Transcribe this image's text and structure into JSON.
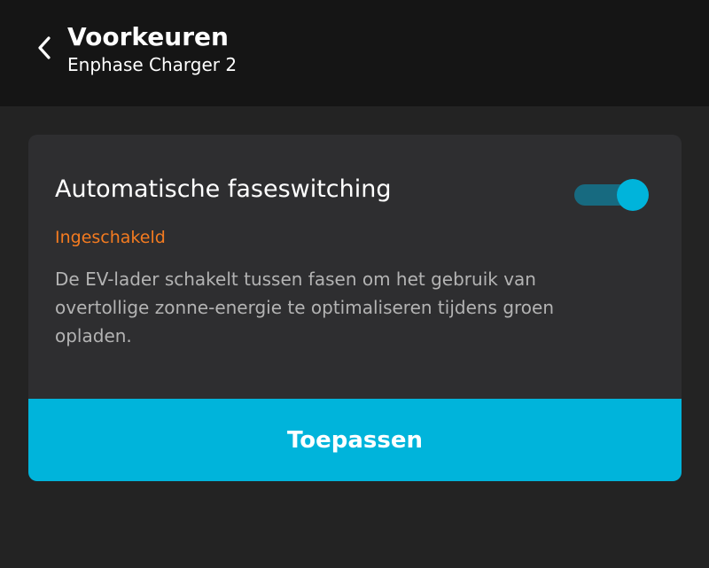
{
  "header": {
    "title": "Voorkeuren",
    "subtitle": "Enphase Charger 2",
    "back_icon": "chevron-left-icon"
  },
  "setting": {
    "title": "Automatische faseswitching",
    "toggle_on": true,
    "status": "Ingeschakeld",
    "description": "De EV-lader schakelt tussen fasen om het gebruik van overtollige zonne-energie te optimaliseren tijdens groen opladen."
  },
  "actions": {
    "apply_label": "Toepassen"
  },
  "colors": {
    "accent": "#00b4db",
    "toggle_track": "#176a80",
    "status_text": "#f47b20"
  }
}
